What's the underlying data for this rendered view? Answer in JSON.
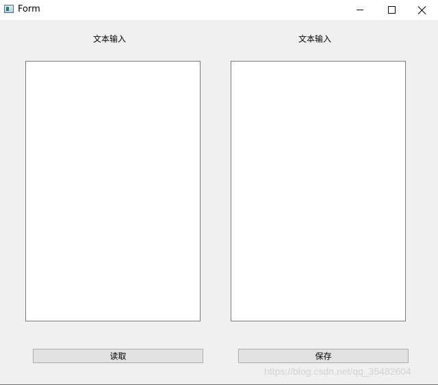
{
  "window": {
    "title": "Form",
    "icon": "app-window-icon",
    "controls": {
      "minimize": "minimize-icon",
      "maximize": "maximize-icon",
      "close": "close-icon"
    }
  },
  "left_panel": {
    "label": "文本输入",
    "text_value": "",
    "button_label": "读取"
  },
  "right_panel": {
    "label": "文本输入",
    "text_value": "",
    "button_label": "保存"
  },
  "watermark": "https://blog.csdn.net/qq_35482604",
  "colors": {
    "window_bg": "#f0f0f0",
    "titlebar_bg": "#ffffff",
    "button_bg": "#e1e1e1",
    "button_border": "#adadad",
    "textbox_border": "#7a7a7a"
  }
}
